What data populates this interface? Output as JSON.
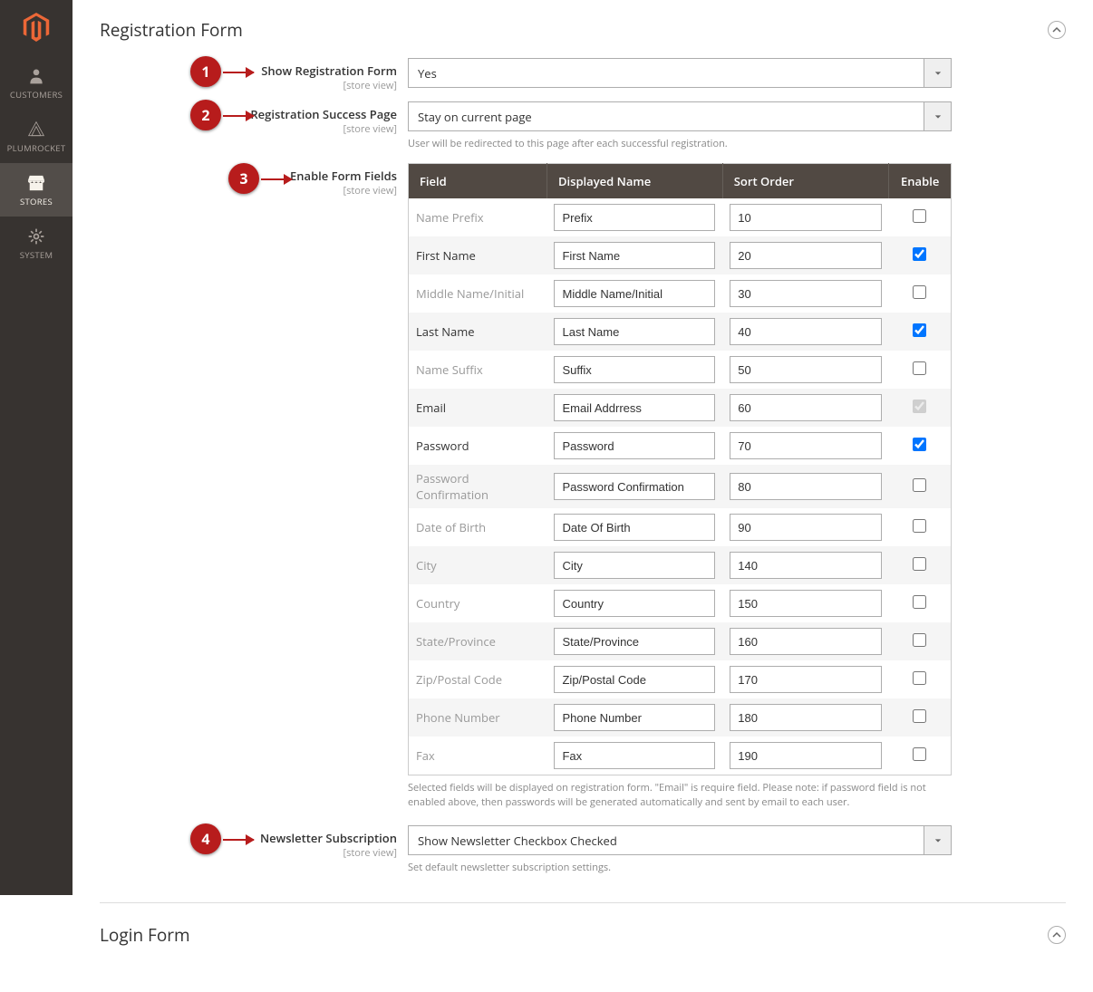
{
  "sidebar": {
    "items": [
      {
        "label": "CUSTOMERS"
      },
      {
        "label": "PLUMROCKET"
      },
      {
        "label": "STORES"
      },
      {
        "label": "SYSTEM"
      }
    ]
  },
  "section_registration_title": "Registration Form",
  "section_login_title": "Login Form",
  "annotations": {
    "b1": "1",
    "b2": "2",
    "b3": "3",
    "b4": "4"
  },
  "fields": {
    "show_reg": {
      "label": "Show Registration Form",
      "scope": "[store view]",
      "value": "Yes"
    },
    "success_page": {
      "label": "Registration Success Page",
      "scope": "[store view]",
      "value": "Stay on current page",
      "hint": "User will be redirected to this page after each successful registration."
    },
    "enable_fields": {
      "label": "Enable Form Fields",
      "scope": "[store view]"
    },
    "newsletter": {
      "label": "Newsletter Subscription",
      "scope": "[store view]",
      "value": "Show Newsletter Checkbox Checked",
      "hint": "Set default newsletter subscription settings."
    }
  },
  "table": {
    "headers": {
      "field": "Field",
      "name": "Displayed Name",
      "sort": "Sort Order",
      "enable": "Enable"
    },
    "rows": [
      {
        "field": "Name Prefix",
        "name": "Prefix",
        "sort": "10",
        "enabled": false,
        "active": false,
        "disabled": false
      },
      {
        "field": "First Name",
        "name": "First Name",
        "sort": "20",
        "enabled": true,
        "active": true,
        "disabled": false
      },
      {
        "field": "Middle Name/Initial",
        "name": "Middle Name/Initial",
        "sort": "30",
        "enabled": false,
        "active": false,
        "disabled": false
      },
      {
        "field": "Last Name",
        "name": "Last Name",
        "sort": "40",
        "enabled": true,
        "active": true,
        "disabled": false
      },
      {
        "field": "Name Suffix",
        "name": "Suffix",
        "sort": "50",
        "enabled": false,
        "active": false,
        "disabled": false
      },
      {
        "field": "Email",
        "name": "Email Addrress",
        "sort": "60",
        "enabled": true,
        "active": true,
        "disabled": true
      },
      {
        "field": "Password",
        "name": "Password",
        "sort": "70",
        "enabled": true,
        "active": true,
        "disabled": false
      },
      {
        "field": "Password Confirmation",
        "name": "Password Confirmation",
        "sort": "80",
        "enabled": false,
        "active": false,
        "disabled": false
      },
      {
        "field": "Date of Birth",
        "name": "Date Of Birth",
        "sort": "90",
        "enabled": false,
        "active": false,
        "disabled": false
      },
      {
        "field": "City",
        "name": "City",
        "sort": "140",
        "enabled": false,
        "active": false,
        "disabled": false
      },
      {
        "field": "Country",
        "name": "Country",
        "sort": "150",
        "enabled": false,
        "active": false,
        "disabled": false
      },
      {
        "field": "State/Province",
        "name": "State/Province",
        "sort": "160",
        "enabled": false,
        "active": false,
        "disabled": false
      },
      {
        "field": "Zip/Postal Code",
        "name": "Zip/Postal Code",
        "sort": "170",
        "enabled": false,
        "active": false,
        "disabled": false
      },
      {
        "field": "Phone Number",
        "name": "Phone Number",
        "sort": "180",
        "enabled": false,
        "active": false,
        "disabled": false
      },
      {
        "field": "Fax",
        "name": "Fax",
        "sort": "190",
        "enabled": false,
        "active": false,
        "disabled": false
      }
    ],
    "footnote": "Selected fields will be displayed on registration form. \"Email\" is require field. Please note: if password field is not enabled above, then passwords will be generated automatically and sent by email to each user."
  }
}
